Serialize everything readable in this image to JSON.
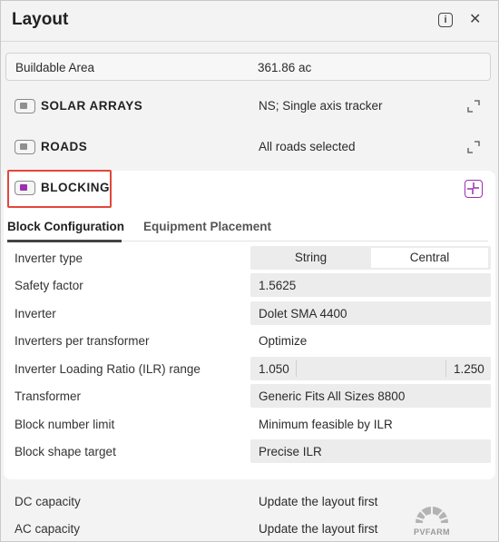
{
  "panel": {
    "title": "Layout"
  },
  "buildable_area": {
    "label": "Buildable Area",
    "value": "361.86 ac"
  },
  "sections": {
    "solar_arrays": {
      "title": "SOLAR ARRAYS",
      "value": "NS; Single axis tracker"
    },
    "roads": {
      "title": "ROADS",
      "value": "All roads selected"
    },
    "blocking": {
      "title": "BLOCKING",
      "accent": "#9b2fb0"
    }
  },
  "tabs": {
    "block_config": "Block Configuration",
    "equipment": "Equipment Placement"
  },
  "params": {
    "inverter_type": {
      "label": "Inverter type",
      "options": [
        "String",
        "Central"
      ],
      "selected": "Central"
    },
    "safety_factor": {
      "label": "Safety factor",
      "value": "1.5625"
    },
    "inverter": {
      "label": "Inverter",
      "value": "Dolet SMA 4400"
    },
    "inverters_per_transformer": {
      "label": "Inverters per transformer",
      "value": "Optimize"
    },
    "ilr_range": {
      "label": "Inverter Loading Ratio (ILR) range",
      "min": "1.050",
      "max": "1.250"
    },
    "transformer": {
      "label": "Transformer",
      "value": "Generic Fits All Sizes 8800"
    },
    "block_number_limit": {
      "label": "Block number limit",
      "value": "Minimum feasible by ILR"
    },
    "block_shape_target": {
      "label": "Block shape target",
      "value": "Precise ILR"
    }
  },
  "footer": {
    "dc_capacity": {
      "label": "DC capacity",
      "value": "Update the layout first"
    },
    "ac_capacity": {
      "label": "AC capacity",
      "value": "Update the layout first"
    }
  },
  "logo": {
    "text": "PVFARM"
  },
  "icons": {
    "info": "info-icon",
    "close": "close-icon",
    "expand": "expand-icon",
    "collapse": "collapse-icon"
  }
}
